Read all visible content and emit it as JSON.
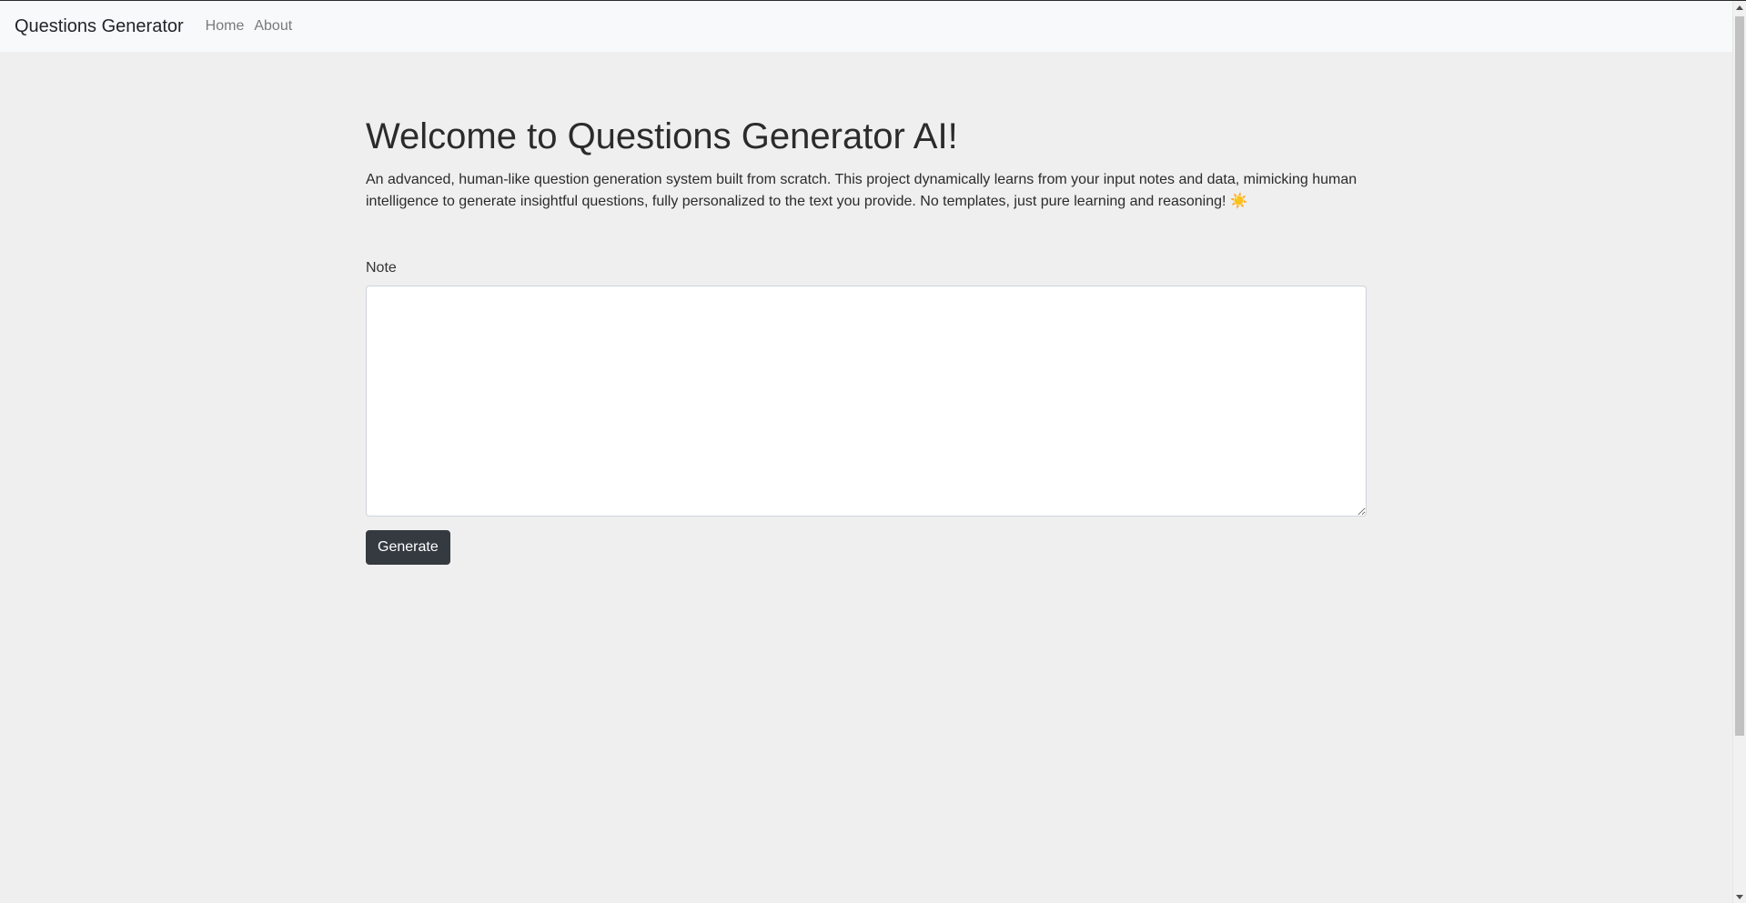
{
  "navbar": {
    "brand": "Questions Generator",
    "links": [
      "Home",
      "About"
    ]
  },
  "main": {
    "title": "Welcome to Questions Generator AI!",
    "intro": "An advanced, human-like question generation system built from scratch. This project dynamically learns from your input notes and data, mimicking human intelligence to generate insightful questions, fully personalized to the text you provide. No templates, just pure learning and reasoning!",
    "intro_icon": "☀️",
    "note_label": "Note",
    "note_value": "",
    "generate_label": "Generate"
  },
  "colors": {
    "background": "#efefef",
    "navbar_bg": "#f8f9fa",
    "button_bg": "#343a40",
    "button_text": "#ffffff"
  }
}
